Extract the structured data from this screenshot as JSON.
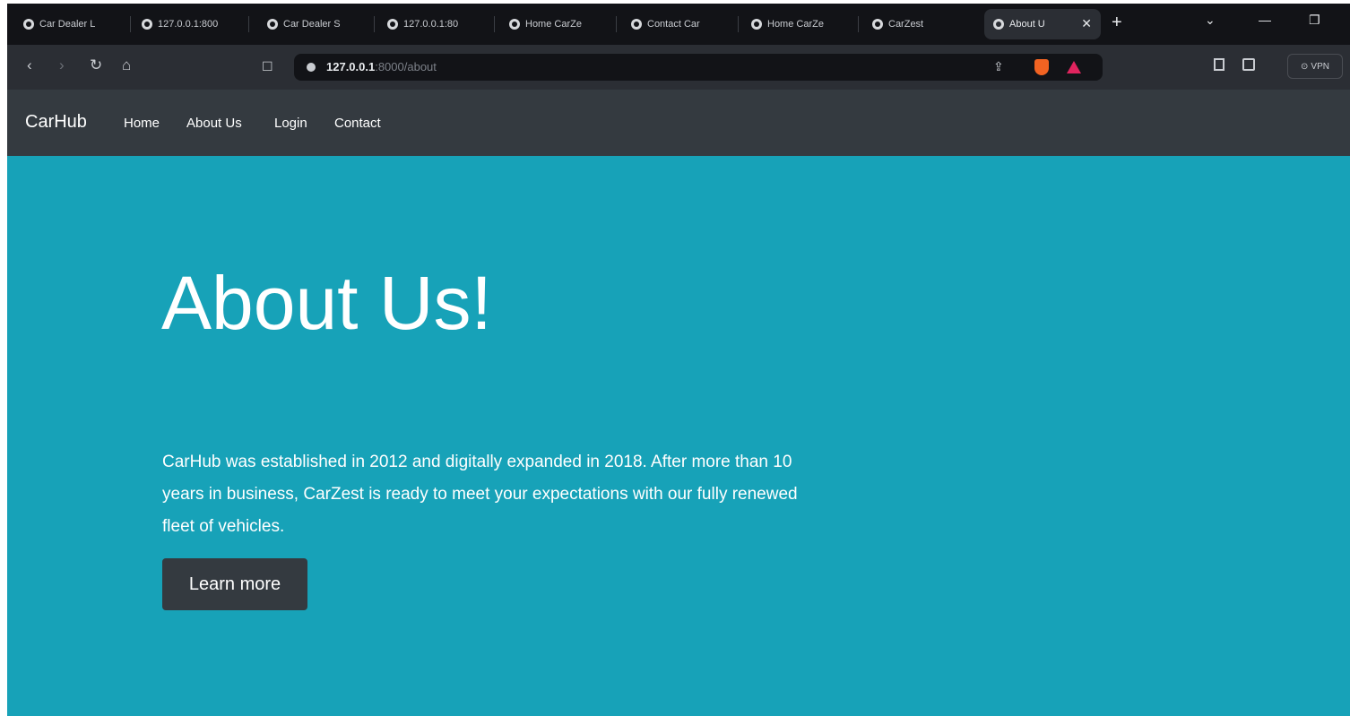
{
  "browser": {
    "tabs": [
      {
        "title": "Car Dealer L"
      },
      {
        "title": "127.0.0.1:800"
      },
      {
        "title": "Car Dealer S"
      },
      {
        "title": "127.0.0.1:80"
      },
      {
        "title": "Home CarZe"
      },
      {
        "title": "Contact Car"
      },
      {
        "title": "Home CarZe"
      },
      {
        "title": "CarZest"
      },
      {
        "title": "About U"
      }
    ],
    "new_tab": "+",
    "url_host": "127.0.0.1",
    "url_path": ":8000/about",
    "vpn_label": "VPN",
    "window_controls": {
      "minimize": "—",
      "maximize": "❐",
      "dropdown": "⌄"
    }
  },
  "site": {
    "brand": "CarHub",
    "nav": [
      "Home",
      "About Us",
      "Login",
      "Contact"
    ],
    "hero": {
      "title": "About Us!",
      "text": "CarHub was established in 2012 and digitally expanded in 2018. After more than 10 years in business, CarZest is ready to meet your expectations with our fully renewed fleet of vehicles.",
      "button": "Learn more"
    }
  },
  "colors": {
    "hero_bg": "#17a2b8",
    "navbar_bg": "#343a40",
    "button_bg": "#343a40"
  }
}
